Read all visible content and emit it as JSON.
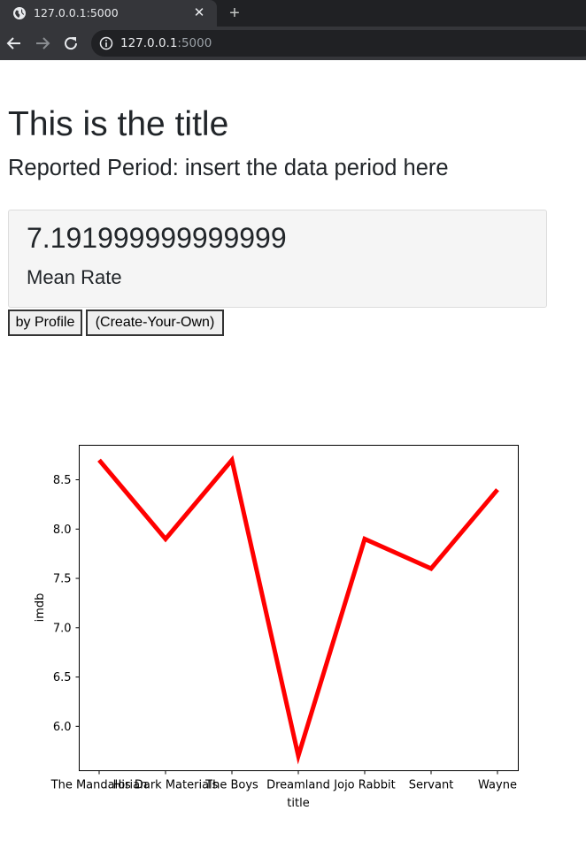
{
  "browser": {
    "tab_title": "127.0.0.1:5000",
    "url_host": "127.0.0.1",
    "url_port": ":5000"
  },
  "page": {
    "title": "This is the title",
    "subtitle": "Reported Period: insert the data period here"
  },
  "metric": {
    "value": "7.191999999999999",
    "label": "Mean Rate"
  },
  "buttons": {
    "profile": "by Profile",
    "create": "(Create-Your-Own)"
  },
  "colors": {
    "line": "#ff0000",
    "chrome_dark": "#202124",
    "chrome_tab": "#35363a",
    "card_bg": "#f5f5f5"
  },
  "chart_data": {
    "type": "line",
    "categories": [
      "The Mandalorian",
      "His Dark Materials",
      "The Boys",
      "Dreamland",
      "Jojo Rabbit",
      "Servant",
      "Wayne"
    ],
    "values": [
      8.7,
      7.9,
      8.7,
      5.7,
      7.9,
      7.6,
      8.4
    ],
    "xlabel": "title",
    "ylabel": "imdb",
    "yticks": [
      6.0,
      6.5,
      7.0,
      7.5,
      8.0,
      8.5
    ],
    "ylim": [
      5.55,
      8.85
    ],
    "grid": false,
    "legend": "none"
  }
}
